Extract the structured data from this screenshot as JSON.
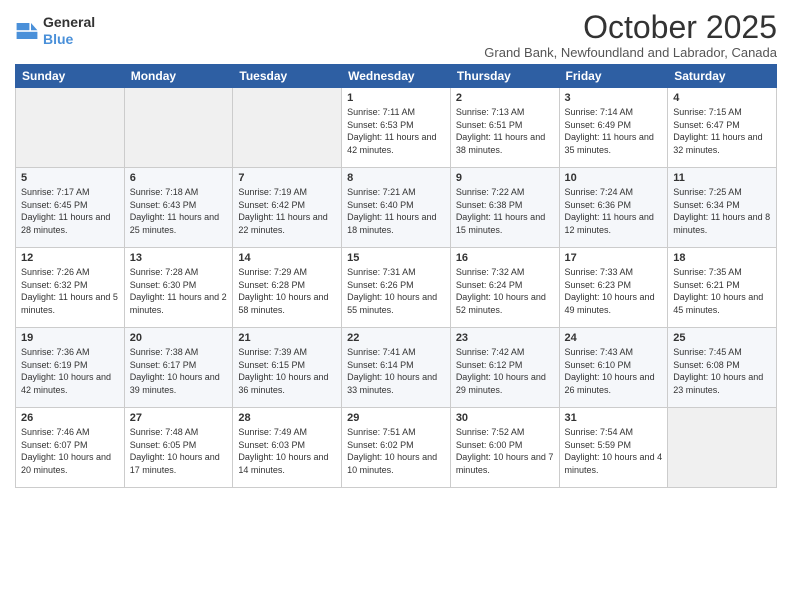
{
  "header": {
    "logo_general": "General",
    "logo_blue": "Blue",
    "month": "October 2025",
    "location": "Grand Bank, Newfoundland and Labrador, Canada"
  },
  "days_of_week": [
    "Sunday",
    "Monday",
    "Tuesday",
    "Wednesday",
    "Thursday",
    "Friday",
    "Saturday"
  ],
  "weeks": [
    [
      {
        "day": "",
        "info": ""
      },
      {
        "day": "",
        "info": ""
      },
      {
        "day": "",
        "info": ""
      },
      {
        "day": "1",
        "info": "Sunrise: 7:11 AM\nSunset: 6:53 PM\nDaylight: 11 hours and 42 minutes."
      },
      {
        "day": "2",
        "info": "Sunrise: 7:13 AM\nSunset: 6:51 PM\nDaylight: 11 hours and 38 minutes."
      },
      {
        "day": "3",
        "info": "Sunrise: 7:14 AM\nSunset: 6:49 PM\nDaylight: 11 hours and 35 minutes."
      },
      {
        "day": "4",
        "info": "Sunrise: 7:15 AM\nSunset: 6:47 PM\nDaylight: 11 hours and 32 minutes."
      }
    ],
    [
      {
        "day": "5",
        "info": "Sunrise: 7:17 AM\nSunset: 6:45 PM\nDaylight: 11 hours and 28 minutes."
      },
      {
        "day": "6",
        "info": "Sunrise: 7:18 AM\nSunset: 6:43 PM\nDaylight: 11 hours and 25 minutes."
      },
      {
        "day": "7",
        "info": "Sunrise: 7:19 AM\nSunset: 6:42 PM\nDaylight: 11 hours and 22 minutes."
      },
      {
        "day": "8",
        "info": "Sunrise: 7:21 AM\nSunset: 6:40 PM\nDaylight: 11 hours and 18 minutes."
      },
      {
        "day": "9",
        "info": "Sunrise: 7:22 AM\nSunset: 6:38 PM\nDaylight: 11 hours and 15 minutes."
      },
      {
        "day": "10",
        "info": "Sunrise: 7:24 AM\nSunset: 6:36 PM\nDaylight: 11 hours and 12 minutes."
      },
      {
        "day": "11",
        "info": "Sunrise: 7:25 AM\nSunset: 6:34 PM\nDaylight: 11 hours and 8 minutes."
      }
    ],
    [
      {
        "day": "12",
        "info": "Sunrise: 7:26 AM\nSunset: 6:32 PM\nDaylight: 11 hours and 5 minutes."
      },
      {
        "day": "13",
        "info": "Sunrise: 7:28 AM\nSunset: 6:30 PM\nDaylight: 11 hours and 2 minutes."
      },
      {
        "day": "14",
        "info": "Sunrise: 7:29 AM\nSunset: 6:28 PM\nDaylight: 10 hours and 58 minutes."
      },
      {
        "day": "15",
        "info": "Sunrise: 7:31 AM\nSunset: 6:26 PM\nDaylight: 10 hours and 55 minutes."
      },
      {
        "day": "16",
        "info": "Sunrise: 7:32 AM\nSunset: 6:24 PM\nDaylight: 10 hours and 52 minutes."
      },
      {
        "day": "17",
        "info": "Sunrise: 7:33 AM\nSunset: 6:23 PM\nDaylight: 10 hours and 49 minutes."
      },
      {
        "day": "18",
        "info": "Sunrise: 7:35 AM\nSunset: 6:21 PM\nDaylight: 10 hours and 45 minutes."
      }
    ],
    [
      {
        "day": "19",
        "info": "Sunrise: 7:36 AM\nSunset: 6:19 PM\nDaylight: 10 hours and 42 minutes."
      },
      {
        "day": "20",
        "info": "Sunrise: 7:38 AM\nSunset: 6:17 PM\nDaylight: 10 hours and 39 minutes."
      },
      {
        "day": "21",
        "info": "Sunrise: 7:39 AM\nSunset: 6:15 PM\nDaylight: 10 hours and 36 minutes."
      },
      {
        "day": "22",
        "info": "Sunrise: 7:41 AM\nSunset: 6:14 PM\nDaylight: 10 hours and 33 minutes."
      },
      {
        "day": "23",
        "info": "Sunrise: 7:42 AM\nSunset: 6:12 PM\nDaylight: 10 hours and 29 minutes."
      },
      {
        "day": "24",
        "info": "Sunrise: 7:43 AM\nSunset: 6:10 PM\nDaylight: 10 hours and 26 minutes."
      },
      {
        "day": "25",
        "info": "Sunrise: 7:45 AM\nSunset: 6:08 PM\nDaylight: 10 hours and 23 minutes."
      }
    ],
    [
      {
        "day": "26",
        "info": "Sunrise: 7:46 AM\nSunset: 6:07 PM\nDaylight: 10 hours and 20 minutes."
      },
      {
        "day": "27",
        "info": "Sunrise: 7:48 AM\nSunset: 6:05 PM\nDaylight: 10 hours and 17 minutes."
      },
      {
        "day": "28",
        "info": "Sunrise: 7:49 AM\nSunset: 6:03 PM\nDaylight: 10 hours and 14 minutes."
      },
      {
        "day": "29",
        "info": "Sunrise: 7:51 AM\nSunset: 6:02 PM\nDaylight: 10 hours and 10 minutes."
      },
      {
        "day": "30",
        "info": "Sunrise: 7:52 AM\nSunset: 6:00 PM\nDaylight: 10 hours and 7 minutes."
      },
      {
        "day": "31",
        "info": "Sunrise: 7:54 AM\nSunset: 5:59 PM\nDaylight: 10 hours and 4 minutes."
      },
      {
        "day": "",
        "info": ""
      }
    ]
  ]
}
